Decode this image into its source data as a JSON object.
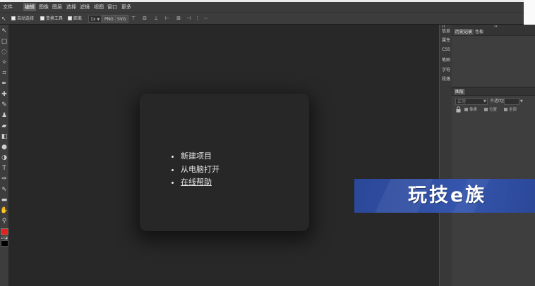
{
  "menu_bar": {
    "items": [
      "文件",
      "编辑",
      "图像",
      "图层",
      "选择",
      "滤镜",
      "视图",
      "窗口",
      "更多"
    ]
  },
  "options_bar": {
    "tool_icon": "move-tool-icon",
    "auto_select": {
      "label": "自动选择",
      "checked": false
    },
    "transform_controls": {
      "label": "变换工具",
      "checked": false
    },
    "distances": {
      "label": "距离",
      "checked": false
    },
    "scale": "1x",
    "export_png": "PNG",
    "export_svg": "SVG",
    "align_icons": [
      "align-top-icon",
      "align-vcenter-icon",
      "align-bottom-icon",
      "align-left-icon",
      "align-hcenter-icon",
      "align-right-icon",
      "distribute-icon",
      "distribute-spacing-icon"
    ]
  },
  "toolbar": {
    "tools": [
      "move-tool-icon",
      "marquee-tool-icon",
      "lasso-tool-icon",
      "magic-wand-tool-icon",
      "crop-tool-icon",
      "eyedropper-tool-icon",
      "healing-brush-tool-icon",
      "brush-tool-icon",
      "clone-stamp-tool-icon",
      "eraser-tool-icon",
      "gradient-tool-icon",
      "blur-tool-icon",
      "dodge-tool-icon",
      "type-tool-icon",
      "pen-tool-icon",
      "path-select-tool-icon",
      "shape-tool-icon",
      "hand-tool-icon",
      "zoom-tool-icon"
    ],
    "foreground_color": "#e3221e",
    "background_color": "#000000"
  },
  "start_panel": {
    "items": [
      {
        "label": "新建项目"
      },
      {
        "label": "从电脑打开"
      },
      {
        "label": "在线帮助",
        "link": true
      }
    ]
  },
  "side_tabs": [
    "信息",
    "属性",
    "CSS",
    "笔刷",
    "字符",
    "段落"
  ],
  "history_panel": {
    "tabs": [
      "历史记录",
      "色板"
    ]
  },
  "layers_panel": {
    "tab": "图层",
    "blend_mode": "正常",
    "opacity_label": "不透明度:",
    "lock_icon": "lock-icon",
    "lock_options": [
      "像素",
      "位置",
      "全部"
    ]
  },
  "watermark": {
    "text": "玩技e族",
    "color_start": "#2b4798",
    "color_end": "#3556ad"
  }
}
